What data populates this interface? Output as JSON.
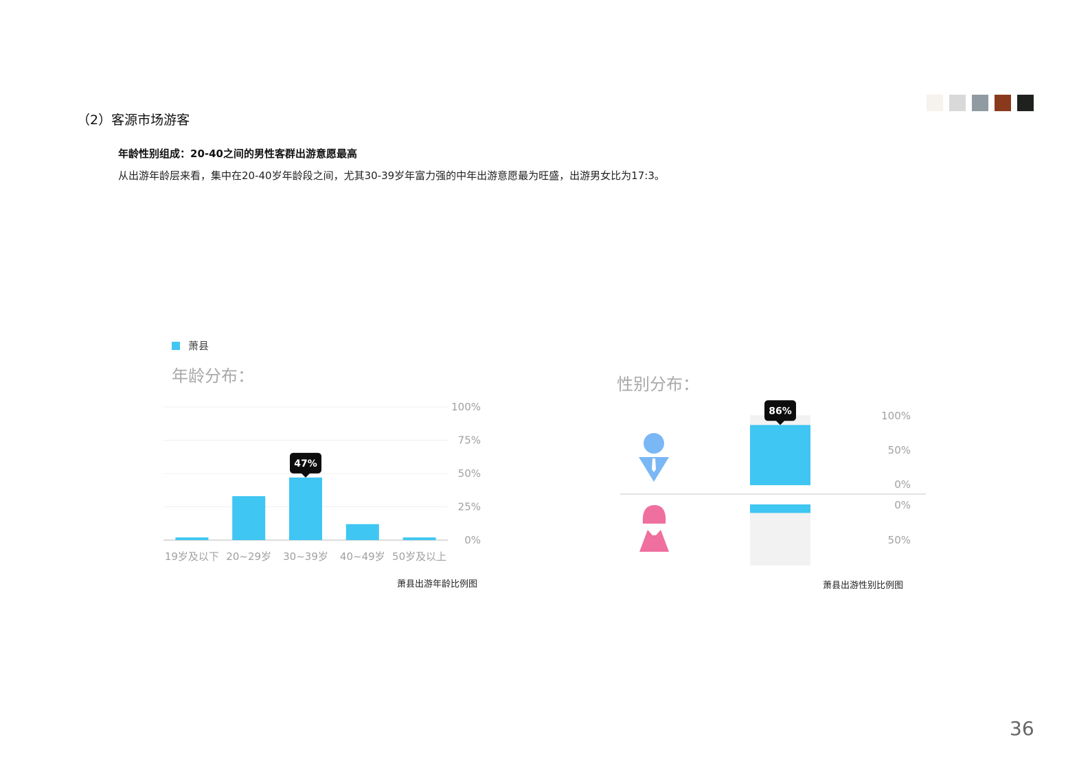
{
  "page": {
    "section_title": "（2）客源市场游客",
    "sub_heading": "年龄性别组成：20-40之间的男性客群出游意愿最高",
    "body_text": "从出游年龄层来看，集中在20-40岁年龄段之间，尤其30-39岁年富力强的中年出游意愿最为旺盛，出游男女比为17:3。",
    "page_number": "36",
    "swatch_colors": [
      "#f6f2ee",
      "#d9d9d9",
      "#8f9aa1",
      "#8a3a1c",
      "#1f211f"
    ]
  },
  "legend": {
    "label": "萧县",
    "color": "#40c6f2"
  },
  "captions": {
    "age": "萧县出游年龄比例图",
    "gender": "萧县出游性别比例图"
  },
  "chart_data": [
    {
      "type": "bar",
      "title": "年龄分布：",
      "categories": [
        "19岁及以下",
        "20~29岁",
        "30~39岁",
        "40~49岁",
        "50岁及以上"
      ],
      "series": [
        {
          "name": "萧县",
          "values": [
            2,
            33,
            47,
            12,
            2
          ]
        }
      ],
      "ylim": [
        0,
        100
      ],
      "yticks": [
        "0%",
        "25%",
        "50%",
        "75%",
        "100%"
      ],
      "ytick_values": [
        0,
        25,
        50,
        75,
        100
      ],
      "highlight": {
        "index": 2,
        "label": "47%"
      },
      "bar_color": "#40c6f2",
      "grid": true,
      "legend_position": "top-left"
    },
    {
      "type": "bar",
      "title": "性别分布：",
      "categories": [
        "男",
        "女"
      ],
      "series": [
        {
          "name": "萧县",
          "values": [
            86,
            14
          ]
        }
      ],
      "upper_ticks": [
        "100%",
        "50%",
        "0%"
      ],
      "lower_ticks": [
        "0%",
        "50%"
      ],
      "highlight": {
        "index": 0,
        "label": "86%"
      },
      "bar_color": "#40c6f2",
      "track_color": "#f2f2f2",
      "male_icon_color": "#7ab7f5",
      "female_icon_color": "#ef6f9e"
    }
  ]
}
